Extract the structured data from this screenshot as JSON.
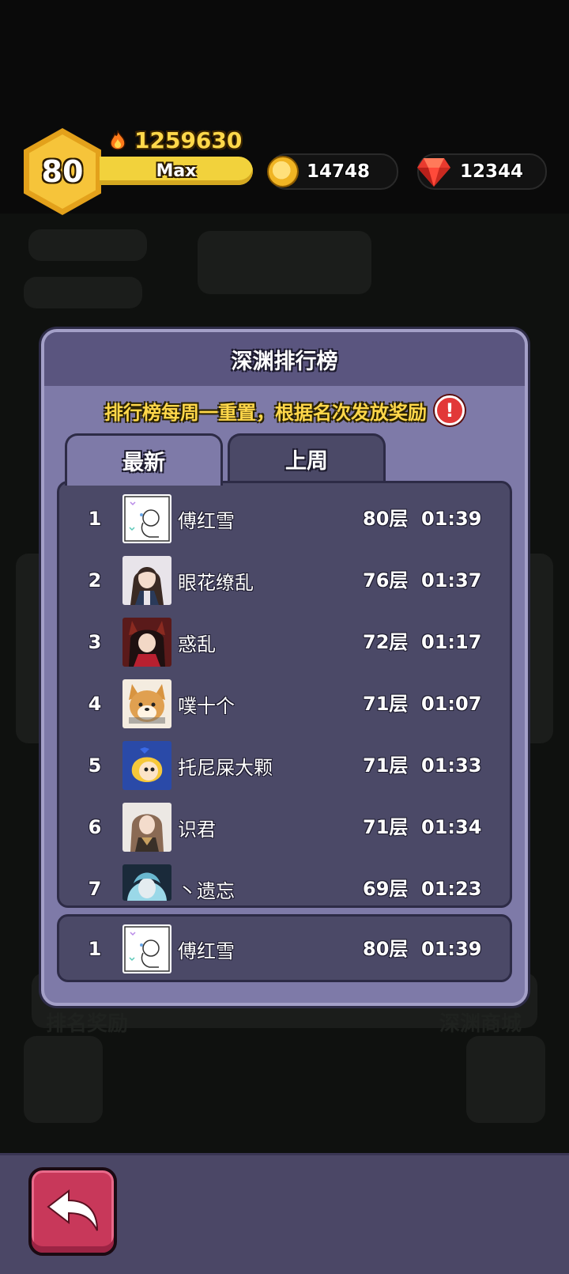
{
  "hud": {
    "level": "80",
    "power": "1259630",
    "exp_label": "Max",
    "gold": "14748",
    "gems": "12344"
  },
  "background_labels": {
    "left": "排名奖励",
    "right": "深渊商城"
  },
  "modal": {
    "title": "深渊排行榜",
    "notice": "排行榜每周一重置，根据名次发放奖励",
    "info_icon": "!",
    "tabs": [
      {
        "label": "最新",
        "active": true
      },
      {
        "label": "上周",
        "active": false
      }
    ],
    "ranking": [
      {
        "rank": "1",
        "name": "傅红雪",
        "floor": "80层",
        "time": "01:39",
        "avatar": "sketch-avatar"
      },
      {
        "rank": "2",
        "name": "眼花缭乱",
        "floor": "76层",
        "time": "01:37",
        "avatar": "anime-girl-dark-hair"
      },
      {
        "rank": "3",
        "name": "惑乱",
        "floor": "72层",
        "time": "01:17",
        "avatar": "fox-ear-girl"
      },
      {
        "rank": "4",
        "name": "噗十个",
        "floor": "71层",
        "time": "01:07",
        "avatar": "shiba-dog"
      },
      {
        "rank": "5",
        "name": "托尼屎大颗",
        "floor": "71层",
        "time": "01:33",
        "avatar": "chibi-blonde"
      },
      {
        "rank": "6",
        "name": "识君",
        "floor": "71层",
        "time": "01:34",
        "avatar": "anime-girl-brown-hair"
      },
      {
        "rank": "7",
        "name": "丶遗忘",
        "floor": "69层",
        "time": "01:23",
        "avatar": "teal-hair-character"
      }
    ],
    "self": {
      "rank": "1",
      "name": "傅红雪",
      "floor": "80层",
      "time": "01:39",
      "avatar": "sketch-avatar"
    }
  },
  "colors": {
    "modal_bg": "#7e7aa8",
    "panel_bg": "#4b4967",
    "notice_text": "#ffd74a",
    "back_button": "#c8385a"
  }
}
